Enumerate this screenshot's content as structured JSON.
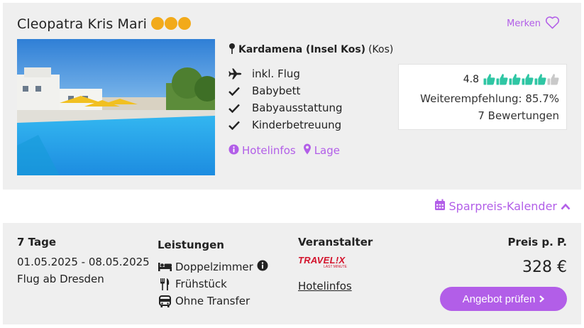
{
  "hotel": {
    "name": "Cleopatra Kris Mari",
    "stars": 3,
    "star_color": "#f2aa1a",
    "merken_label": "Merken",
    "location_main": "Kardamena (Insel Kos)",
    "location_region": "(Kos)",
    "features": [
      {
        "icon": "plane-icon",
        "label": "inkl. Flug"
      },
      {
        "icon": "check-icon",
        "label": "Babybett"
      },
      {
        "icon": "check-icon",
        "label": "Babyausstattung"
      },
      {
        "icon": "check-icon",
        "label": "Kinderbetreuung"
      }
    ],
    "links": {
      "hotelinfos": "Hotelinfos",
      "lage": "Lage"
    }
  },
  "rating": {
    "score": "4.8",
    "thumbs_filled": 5,
    "thumbs_total": 6,
    "recommendation": "Weiterempfehlung: 85.7%",
    "reviews": "7 Bewertungen",
    "thumb_color": "#2fc6a4"
  },
  "calendar": {
    "label": "Sparpreis-Kalender"
  },
  "offer": {
    "duration": "7 Tage",
    "dates": "01.05.2025 - 08.05.2025",
    "departure": "Flug ab Dresden",
    "services_heading": "Leistungen",
    "services": [
      {
        "icon": "bed-icon",
        "label": "Doppelzimmer"
      },
      {
        "icon": "utensils-icon",
        "label": "Frühstück"
      },
      {
        "icon": "bus-icon",
        "label": "Ohne Transfer"
      }
    ],
    "operator_heading": "Veranstalter",
    "operator_logo_text": "TRAVEL!X",
    "operator_logo_sub": "LAST MINUTE",
    "operator_link": "Hotelinfos",
    "price_heading": "Preis p. P.",
    "price": "328 €",
    "cta_label": "Angebot prüfen"
  },
  "accent_color": "#b25ee8"
}
